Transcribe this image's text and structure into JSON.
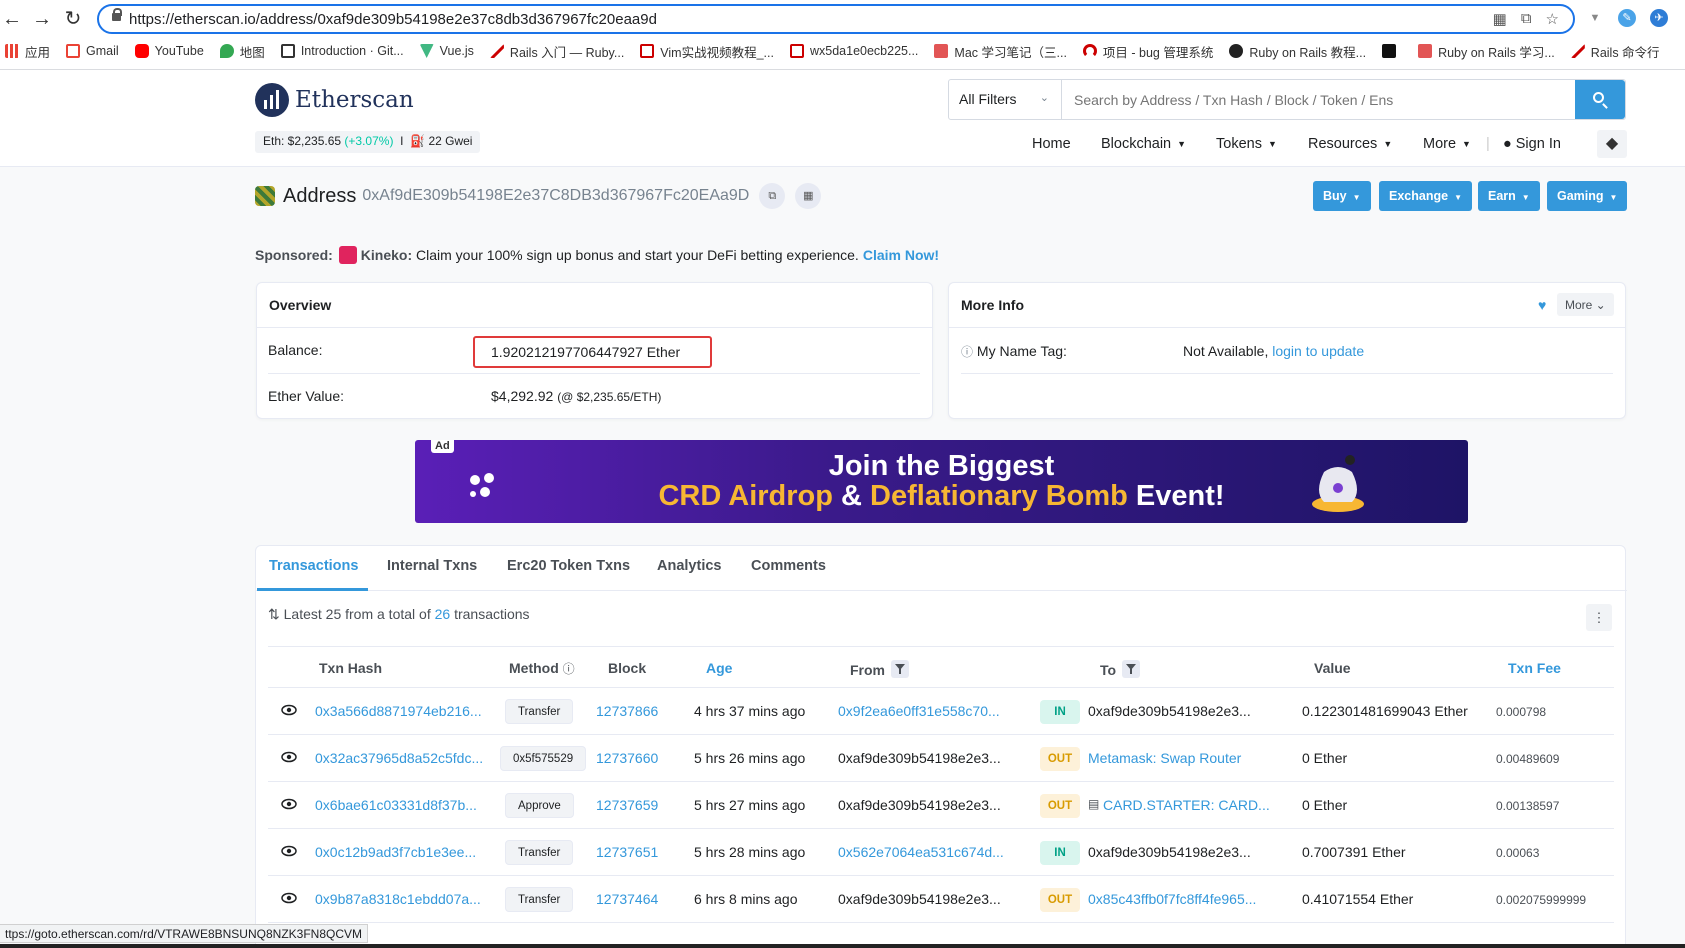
{
  "browser": {
    "url": "https://etherscan.io/address/0xaf9de309b54198e2e37c8db3d367967fc20eaa9d",
    "bookmarks": [
      "应用",
      "Gmail",
      "YouTube",
      "地图",
      "Introduction · Git...",
      "Vue.js",
      "Rails 入门 — Ruby...",
      "Vim实战视频教程_...",
      "wx5da1e0ecb225...",
      "Mac 学习笔记（三...",
      "项目 - bug 管理系统",
      "Ruby on Rails 教程...",
      "",
      "Ruby on Rails 学习...",
      "Rails 命令行"
    ],
    "status_url": "ttps://goto.etherscan.com/rd/VTRAWE8BNSUNQ8NZK3FN8QCVM"
  },
  "header": {
    "logo_text": "Etherscan",
    "eth_price_label": "Eth: $2,235.65",
    "eth_change": "(+3.07%)",
    "separator": "I",
    "gas": "22 Gwei",
    "filter_label": "All Filters",
    "search_placeholder": "Search by Address / Txn Hash / Block / Token / Ens",
    "nav": {
      "home": "Home",
      "blockchain": "Blockchain",
      "tokens": "Tokens",
      "resources": "Resources",
      "more": "More",
      "sign_in": "Sign In"
    }
  },
  "address": {
    "title": "Address",
    "hash": "0xAf9dE309b54198E2e37C8DB3d367967Fc20EAa9D",
    "buttons": {
      "buy": "Buy",
      "exchange": "Exchange",
      "earn": "Earn",
      "gaming": "Gaming"
    }
  },
  "sponsored": {
    "label": "Sponsored:",
    "brand": "Kineko:",
    "text": "Claim your 100% sign up bonus and start your DeFi betting experience.",
    "cta": "Claim Now!"
  },
  "overview": {
    "title": "Overview",
    "balance_label": "Balance:",
    "balance_value": "1.920212197706447927 Ether",
    "value_label": "Ether Value:",
    "value_amount": "$4,292.92",
    "value_rate": "(@ $2,235.65/ETH)"
  },
  "more_info": {
    "title": "More Info",
    "more_button": "More",
    "name_tag_label": "My Name Tag:",
    "name_tag_value": "Not Available,",
    "name_tag_link": "login to update"
  },
  "ad": {
    "tag": "Ad",
    "line1": "Join the  Biggest",
    "line2_part1": "CRD Airdrop",
    "line2_part2": " & ",
    "line2_part3": "Deflationary Bomb",
    "line2_part4": " Event!"
  },
  "tabs": [
    "Transactions",
    "Internal Txns",
    "Erc20 Token Txns",
    "Analytics",
    "Comments"
  ],
  "summary": {
    "prefix": "Latest 25 from a total of",
    "count": "26",
    "suffix": "transactions"
  },
  "table": {
    "headers": {
      "hash": "Txn Hash",
      "method": "Method",
      "block": "Block",
      "age": "Age",
      "from": "From",
      "to": "To",
      "value": "Value",
      "fee": "Txn Fee"
    },
    "rows": [
      {
        "hash": "0x3a566d8871974eb216...",
        "method": "Transfer",
        "block": "12737866",
        "age": "4 hrs 37 mins ago",
        "from": "0x9f2ea6e0ff31e558c70...",
        "dir": "IN",
        "to": "0xaf9de309b54198e2e3...",
        "value": "0.122301481699043 Ether",
        "fee": "0.000798"
      },
      {
        "hash": "0x32ac37965d8a52c5fdc...",
        "method": "0x5f575529",
        "block": "12737660",
        "age": "5 hrs 26 mins ago",
        "from": "0xaf9de309b54198e2e3...",
        "dir": "OUT",
        "to": "Metamask: Swap Router",
        "value": "0 Ether",
        "fee": "0.00489609"
      },
      {
        "hash": "0x6bae61c03331d8f37b...",
        "method": "Approve",
        "block": "12737659",
        "age": "5 hrs 27 mins ago",
        "from": "0xaf9de309b54198e2e3...",
        "dir": "OUT",
        "to": "CARD.STARTER: CARD...",
        "value": "0 Ether",
        "fee": "0.00138597"
      },
      {
        "hash": "0x0c12b9ad3f7cb1e3ee...",
        "method": "Transfer",
        "block": "12737651",
        "age": "5 hrs 28 mins ago",
        "from": "0x562e7064ea531c674d...",
        "dir": "IN",
        "to": "0xaf9de309b54198e2e3...",
        "value": "0.7007391 Ether",
        "fee": "0.00063"
      },
      {
        "hash": "0x9b87a8318c1ebdd07a...",
        "method": "Transfer",
        "block": "12737464",
        "age": "6 hrs 8 mins ago",
        "from": "0xaf9de309b54198e2e3...",
        "dir": "OUT",
        "to": "0x85c43ffb0f7fc8ff4fe965...",
        "value": "0.41071554 Ether",
        "fee": "0.002075999999"
      }
    ]
  },
  "colors": {
    "accent": "#3498db",
    "in": "#00a186",
    "out": "#d89b00",
    "highlight": "#e03a3a"
  }
}
